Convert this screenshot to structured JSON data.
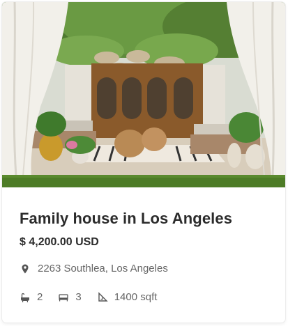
{
  "listing": {
    "title": "Family house in Los Angeles",
    "price": "$ 4,200.00 USD",
    "address": "2263 Southlea, Los Angeles",
    "features": [
      {
        "icon": "bathtub-icon",
        "value": "2"
      },
      {
        "icon": "bed-icon",
        "value": "3"
      },
      {
        "icon": "area-icon",
        "value": "1400 sqft"
      }
    ],
    "address_icon": "location-pin-icon",
    "photo_icon": "property-photo"
  },
  "colors": {
    "text": "#2b2b2b",
    "muted": "#666666",
    "icon": "#555555"
  }
}
